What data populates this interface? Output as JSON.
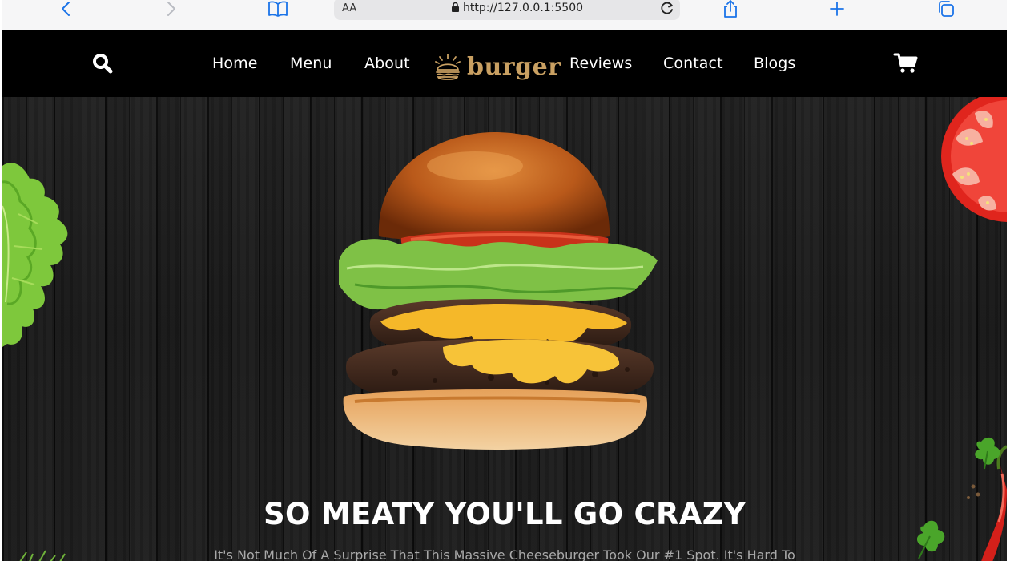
{
  "browser": {
    "text_size_label": "AA",
    "url": "http://127.0.0.1:5500",
    "accent_color": "#1a73e8"
  },
  "header": {
    "logo_text": "burger",
    "nav": {
      "home": "Home",
      "menu": "Menu",
      "about": "About",
      "reviews": "Reviews",
      "contact": "Contact",
      "blogs": "Blogs"
    },
    "icons": [
      "search-icon",
      "cart-icon"
    ]
  },
  "hero": {
    "title": "SO MEATY YOU'LL GO CRAZY",
    "text": "It's Not Much Of A Surprise That This Massive Cheeseburger Took Our #1 Spot. It's Hard To"
  },
  "colors": {
    "header_bg": "#000000",
    "logo": "#c9a062",
    "hero_bg": "#141414",
    "hero_text": "#a9a9a9"
  }
}
